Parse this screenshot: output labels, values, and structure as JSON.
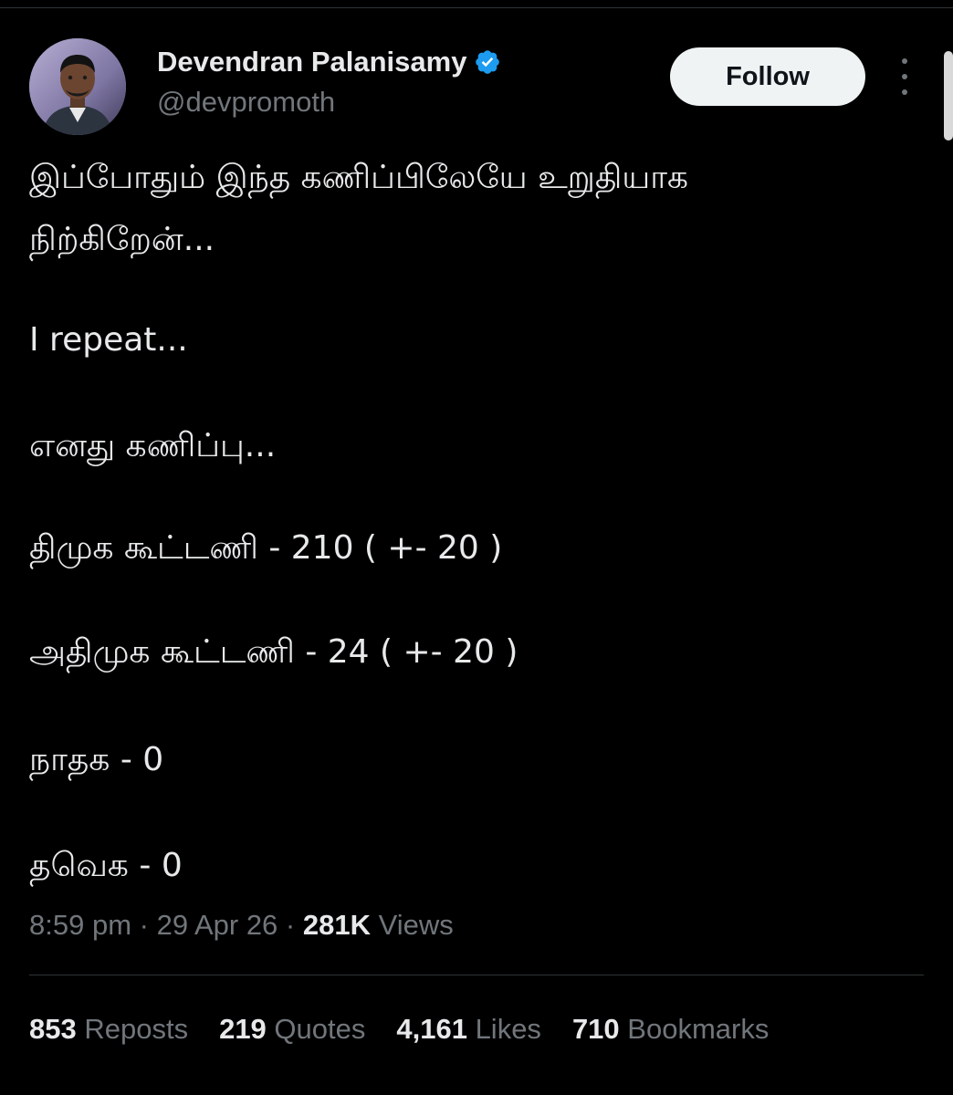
{
  "author": {
    "display_name": "Devendran Palanisamy",
    "handle": "@devpromoth",
    "verified_icon": "verified-badge-icon",
    "verified_color": "#1d9bf0"
  },
  "follow_label": "Follow",
  "more_icon": "more-vertical-icon",
  "tweet": {
    "lines": [
      "இப்போதும் இந்த கணிப்பிலேயே உறுதியாக",
      "நிற்கிறேன்...",
      "I repeat...",
      "எனது கணிப்பு...",
      "திமுக கூட்டணி - 210 ( +- 20 )",
      "அதிமுக கூட்டணி - 24 ( +- 20 )",
      "நாதக - 0",
      "தவெக - 0"
    ]
  },
  "meta": {
    "time": "8:59 pm",
    "sep1": " · ",
    "date": "29 Apr 26",
    "sep2": " · ",
    "views_count": "281K",
    "views_label": " Views"
  },
  "stats": {
    "reposts_count": "853",
    "reposts_label": " Reposts",
    "quotes_count": "219",
    "quotes_label": " Quotes",
    "likes_count": "4,161",
    "likes_label": " Likes",
    "bookmarks_count": "710",
    "bookmarks_label": " Bookmarks"
  },
  "colors": {
    "background": "#000000",
    "text_primary": "#e7e9ea",
    "text_secondary": "#71767b",
    "divider": "#2f3336",
    "follow_bg": "#eff3f4"
  }
}
